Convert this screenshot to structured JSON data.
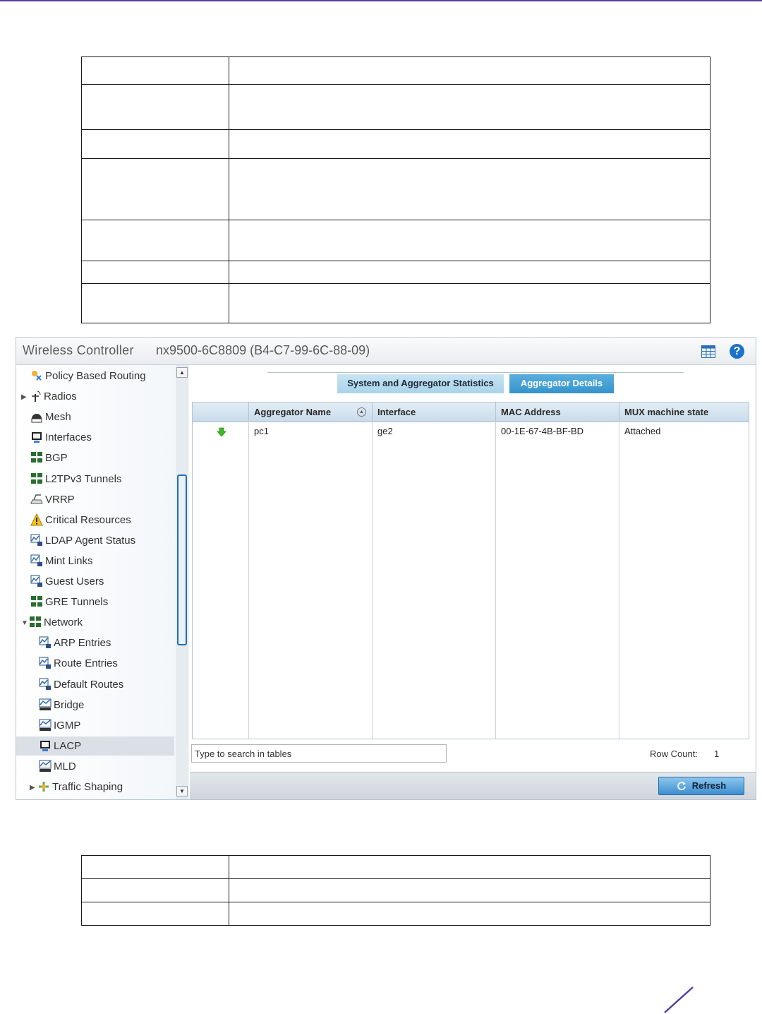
{
  "window": {
    "app_title": "Wireless Controller",
    "device_title": "nx9500-6C8809 (B4-C7-99-6C-88-09)"
  },
  "nav": {
    "items": [
      {
        "label": "Policy Based Routing",
        "icon": "policy-routing-icon"
      },
      {
        "label": "Radios",
        "icon": "radio-antenna-icon",
        "expander": "▶"
      },
      {
        "label": "Mesh",
        "icon": "mesh-icon"
      },
      {
        "label": "Interfaces",
        "icon": "monitor-icon"
      },
      {
        "label": "BGP",
        "icon": "network-grid-icon"
      },
      {
        "label": "L2TPv3 Tunnels",
        "icon": "network-grid-icon"
      },
      {
        "label": "VRRP",
        "icon": "router-icon"
      },
      {
        "label": "Critical Resources",
        "icon": "warning-icon"
      },
      {
        "label": "LDAP Agent Status",
        "icon": "ip-chart-icon"
      },
      {
        "label": "Mint Links",
        "icon": "ip-chart-icon"
      },
      {
        "label": "Guest Users",
        "icon": "ip-chart-icon"
      },
      {
        "label": "GRE Tunnels",
        "icon": "network-grid-icon"
      },
      {
        "label": "Network",
        "icon": "network-grid-icon",
        "expander": "▼"
      },
      {
        "label": "ARP Entries",
        "icon": "ip-chart-icon"
      },
      {
        "label": "Route Entries",
        "icon": "ip-chart-icon"
      },
      {
        "label": "Default Routes",
        "icon": "ip-chart-icon"
      },
      {
        "label": "Bridge",
        "icon": "bridge-icon"
      },
      {
        "label": "IGMP",
        "icon": "bridge-icon"
      },
      {
        "label": "LACP",
        "icon": "monitor-icon"
      },
      {
        "label": "MLD",
        "icon": "bridge-icon"
      },
      {
        "label": "Traffic Shaping",
        "icon": "traffic-shaping-icon",
        "expander": "▶"
      }
    ],
    "selected": "LACP"
  },
  "tabs": [
    {
      "label": "System and Aggregator Statistics"
    },
    {
      "label": "Aggregator Details",
      "active": true
    }
  ],
  "grid": {
    "columns": [
      "",
      "Aggregator Name",
      "Interface",
      "MAC Address",
      "MUX machine state"
    ],
    "rows": [
      {
        "status_icon": "green-down-arrow-icon",
        "aggregator_name": "pc1",
        "interface": "ge2",
        "mac_address": "00-1E-67-4B-BF-BD",
        "mux_state": "Attached"
      }
    ]
  },
  "search": {
    "placeholder": "Type to search in tables"
  },
  "row_count": {
    "label": "Row Count:",
    "value": "1"
  },
  "buttons": {
    "refresh": "Refresh"
  },
  "colors": {
    "accent_purple": "#5a3e9b",
    "active_tab": "#3593cc",
    "inactive_tab": "#a9d3ea",
    "help_blue": "#1a72c9"
  }
}
